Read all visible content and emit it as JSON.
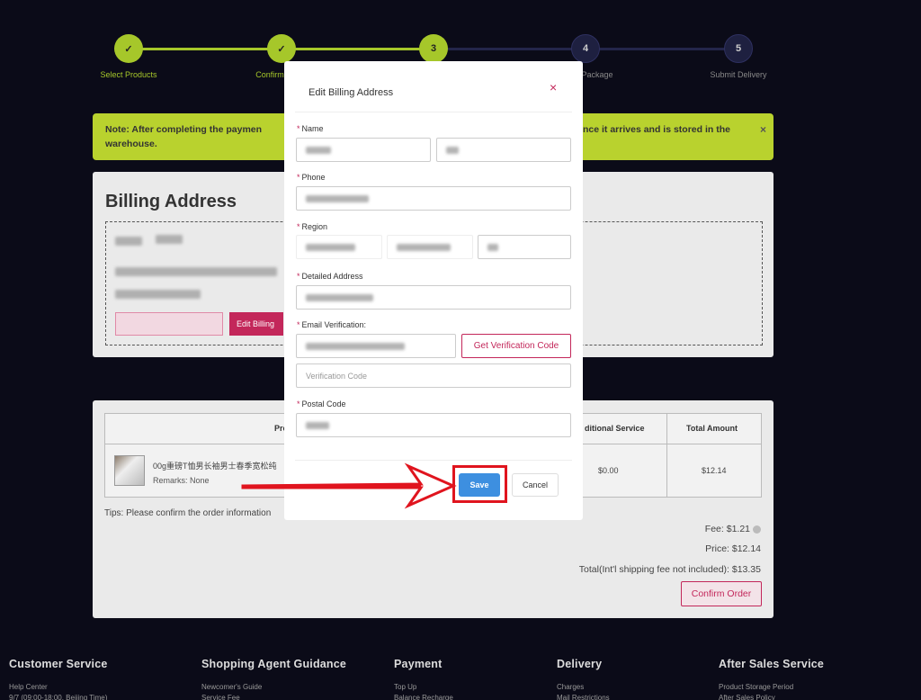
{
  "steps": [
    {
      "label": "Select Products",
      "num": "✓",
      "state": "done"
    },
    {
      "label": "Confirm",
      "num": "✓",
      "state": "done"
    },
    {
      "label": "",
      "num": "3",
      "state": "done"
    },
    {
      "label": "Package",
      "num": "4",
      "state": "todo"
    },
    {
      "label": "Submit Delivery",
      "num": "5",
      "state": "todo"
    }
  ],
  "notice": {
    "text_left": "Note: After completing the paymen",
    "text_right": "nce it arrives and is stored in the",
    "text_line2": "warehouse.",
    "close": "×"
  },
  "billing": {
    "title": "Billing Address",
    "button2": "Edit Billing"
  },
  "order": {
    "col_product": "Pro",
    "col_service": "ditional Service",
    "col_total": "Total Amount",
    "product_name": "00g重磅T恤男长袖男士春季宽松纯",
    "remarks": "Remarks: None",
    "service_value": "$0.00",
    "total_value": "$12.14",
    "tips": "Tips: Please confirm the order information",
    "fee": "Fee: $1.21",
    "price": "Price: $12.14",
    "total": "Total(Int'l shipping fee not included): $13.35",
    "confirm_label": "Confirm Order"
  },
  "modal": {
    "title": "Edit Billing Address",
    "close": "×",
    "name_label": "Name",
    "phone_label": "Phone",
    "region_label": "Region",
    "address_label": "Detailed Address",
    "email_label": "Email Verification:",
    "get_code_label": "Get Verification Code",
    "verification_placeholder": "Verification Code",
    "postal_label": "Postal Code",
    "save_label": "Save",
    "cancel_label": "Cancel",
    "required_mark": "*"
  },
  "footer": [
    {
      "heading": "Customer Service",
      "links": [
        "Help Center",
        "9/7 (09:00-18:00, Beijing Time)"
      ]
    },
    {
      "heading": "Shopping Agent Guidance",
      "links": [
        "Newcomer's Guide",
        "Service Fee"
      ]
    },
    {
      "heading": "Payment",
      "links": [
        "Top Up",
        "Balance Recharge"
      ]
    },
    {
      "heading": "Delivery",
      "links": [
        "Charges",
        "Mail Restrictions"
      ]
    },
    {
      "heading": "After Sales Service",
      "links": [
        "Product Storage Period",
        "After Sales Policy"
      ]
    }
  ],
  "colors": {
    "accent_green": "#a6c72a",
    "accent_pink": "#c3275a",
    "save_blue": "#3d8fe0",
    "highlight_red": "#e0141e"
  }
}
